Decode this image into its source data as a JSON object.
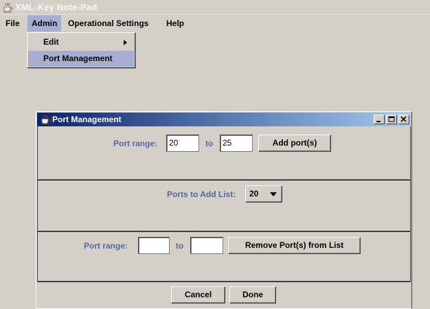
{
  "window": {
    "title": "XML-Key Note-Pad"
  },
  "menubar": {
    "items": [
      {
        "label": "File"
      },
      {
        "label": "Admin"
      },
      {
        "label": "Operational Settings"
      },
      {
        "label": "Help"
      }
    ]
  },
  "admin_menu": {
    "items": [
      {
        "label": "Edit",
        "has_submenu": true
      },
      {
        "label": "Port Management",
        "selected": true
      }
    ]
  },
  "dialog": {
    "title": "Port Management",
    "add_section": {
      "range_label": "Port range:",
      "from_value": "20",
      "to_label": "to",
      "to_value": "25",
      "add_button": "Add port(s)"
    },
    "list_section": {
      "label": "Ports to Add List:",
      "selected": "20"
    },
    "remove_section": {
      "range_label": "Port range:",
      "from_value": "",
      "to_label": "to",
      "to_value": "",
      "remove_button": "Remove Port(s) from List"
    },
    "footer": {
      "cancel_button": "Cancel",
      "done_button": "Done"
    }
  },
  "colors": {
    "highlight": "#a6aed2",
    "label_text": "#5766a6",
    "title_gradient_start": "#0a246a",
    "title_gradient_end": "#a6caf0"
  }
}
